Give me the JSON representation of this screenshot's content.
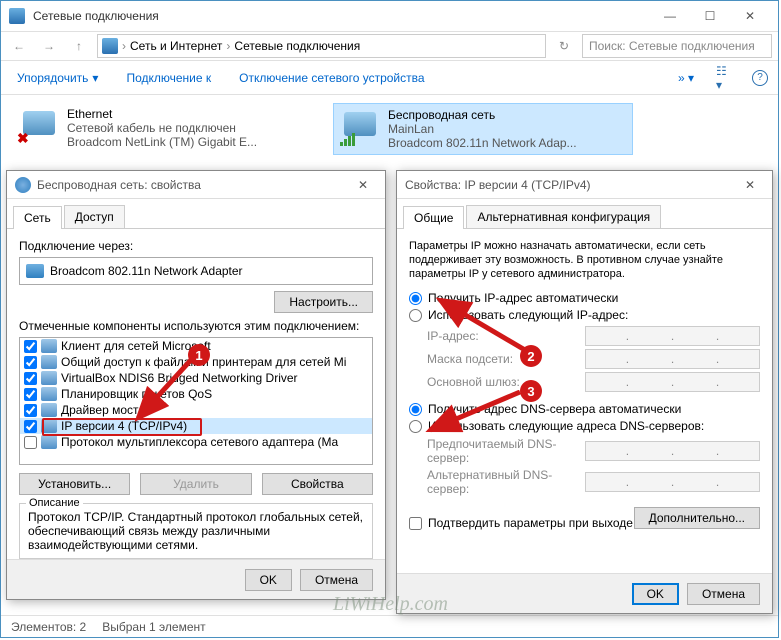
{
  "window": {
    "title": "Сетевые подключения",
    "breadcrumb": {
      "root": "Сеть и Интернет",
      "current": "Сетевые подключения"
    },
    "search_placeholder": "Поиск: Сетевые подключения",
    "nav_refresh": "↻"
  },
  "toolbar": {
    "organize": "Упорядочить",
    "connect": "Подключение к",
    "disable": "Отключение сетевого устройства"
  },
  "connections": [
    {
      "name": "Ethernet",
      "status": "Сетевой кабель не подключен",
      "device": "Broadcom NetLink (TM) Gigabit E...",
      "error": true
    },
    {
      "name": "Беспроводная сеть",
      "status": "MainLan",
      "device": "Broadcom 802.11n Network Adap...",
      "wifi": true
    }
  ],
  "dlg_props": {
    "title": "Беспроводная сеть: свойства",
    "tabs": [
      "Сеть",
      "Доступ"
    ],
    "connect_via": "Подключение через:",
    "adapter": "Broadcom 802.11n Network Adapter",
    "configure": "Настроить...",
    "components_label": "Отмеченные компоненты используются этим подключением:",
    "components": [
      {
        "label": "Клиент для сетей Microsoft",
        "checked": true
      },
      {
        "label": "Общий доступ к файлам и принтерам для сетей Mi",
        "checked": true
      },
      {
        "label": "VirtualBox NDIS6 Bridged Networking Driver",
        "checked": true
      },
      {
        "label": "Планировщик пакетов QoS",
        "checked": true
      },
      {
        "label": "Драйвер моста",
        "checked": true
      },
      {
        "label": "IP версии 4 (TCP/IPv4)",
        "checked": true,
        "selected": true
      },
      {
        "label": "Протокол мультиплексора сетевого адаптера (Ma",
        "checked": false
      }
    ],
    "install": "Установить...",
    "remove": "Удалить",
    "properties": "Свойства",
    "desc_title": "Описание",
    "desc": "Протокол TCP/IP. Стандартный протокол глобальных сетей, обеспечивающий связь между различными взаимодействующими сетями.",
    "ok": "OK",
    "cancel": "Отмена"
  },
  "dlg_ipv4": {
    "title": "Свойства: IP версии 4 (TCP/IPv4)",
    "tabs": [
      "Общие",
      "Альтернативная конфигурация"
    ],
    "intro": "Параметры IP можно назначать автоматически, если сеть поддерживает эту возможность. В противном случае узнайте параметры IP у сетевого администратора.",
    "radio_ip_auto": "Получить IP-адрес автоматически",
    "radio_ip_manual": "Использовать следующий IP-адрес:",
    "lbl_ip": "IP-адрес:",
    "lbl_mask": "Маска подсети:",
    "lbl_gateway": "Основной шлюз:",
    "radio_dns_auto": "Получить адрес DNS-сервера автоматически",
    "radio_dns_manual": "Использовать следующие адреса DNS-серверов:",
    "lbl_dns1": "Предпочитаемый DNS-сервер:",
    "lbl_dns2": "Альтернативный DNS-сервер:",
    "chk_validate": "Подтвердить параметры при выходе",
    "advanced": "Дополнительно...",
    "ok": "OK",
    "cancel": "Отмена"
  },
  "status": {
    "count": "Элементов: 2",
    "sel": "Выбран 1 элемент"
  },
  "watermark": "LiWiHelp.com",
  "annotations": {
    "n1": "1",
    "n2": "2",
    "n3": "3"
  }
}
